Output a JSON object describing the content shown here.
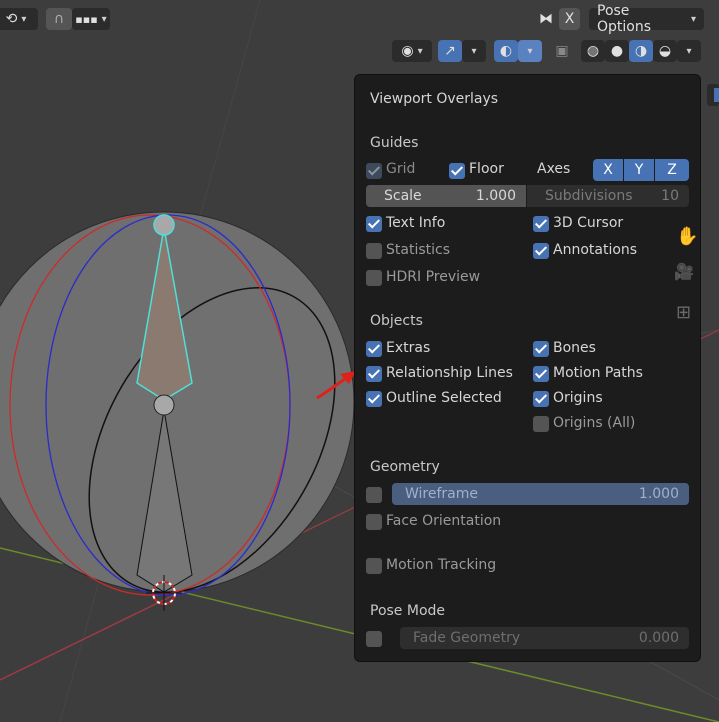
{
  "header": {
    "pose_options": "Pose Options",
    "x_label": "X"
  },
  "overlay": {
    "title": "Viewport Overlays",
    "guides": {
      "heading": "Guides",
      "grid": "Grid",
      "floor": "Floor",
      "axes": "Axes",
      "axis_x": "X",
      "axis_y": "Y",
      "axis_z": "Z",
      "scale_label": "Scale",
      "scale_value": "1.000",
      "subdivisions_label": "Subdivisions",
      "subdivisions_value": "10",
      "text_info": "Text Info",
      "cursor_3d": "3D Cursor",
      "statistics": "Statistics",
      "annotations": "Annotations",
      "hdri_preview": "HDRI Preview"
    },
    "objects": {
      "heading": "Objects",
      "extras": "Extras",
      "bones": "Bones",
      "relationship_lines": "Relationship Lines",
      "motion_paths": "Motion Paths",
      "outline_selected": "Outline Selected",
      "origins": "Origins",
      "origins_all": "Origins (All)"
    },
    "geometry": {
      "heading": "Geometry",
      "wireframe_label": "Wireframe",
      "wireframe_value": "1.000",
      "face_orientation": "Face Orientation",
      "motion_tracking": "Motion Tracking"
    },
    "pose_mode": {
      "heading": "Pose Mode",
      "fade_geometry_label": "Fade Geometry",
      "fade_geometry_value": "0.000"
    }
  },
  "colors": {
    "accent": "#4772b3",
    "popover_bg": "#1c1c1c",
    "viewport_bg": "#3d3d3d",
    "annotation_arrow": "#e0201a"
  }
}
